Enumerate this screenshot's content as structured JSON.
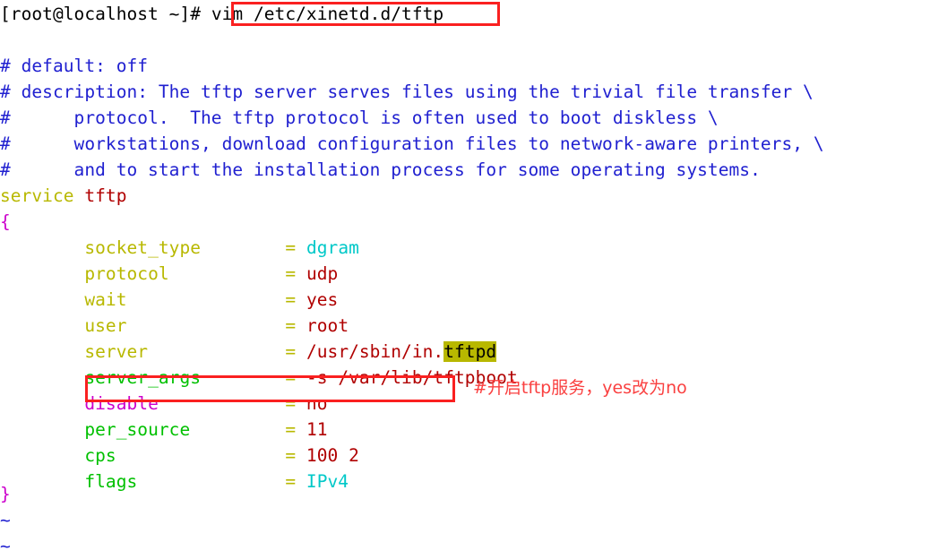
{
  "terminal": {
    "prompt": {
      "user_host": "[root@localhost ~]# ",
      "command": "vim /etc/xinetd.d/tftp"
    },
    "blank": "",
    "comments": [
      "# default: off",
      "# description: The tftp server serves files using the trivial file transfer \\",
      "#      protocol.  The tftp protocol is often used to boot diskless \\",
      "#      workstations, download configuration files to network-aware printers, \\",
      "#      and to start the installation process for some operating systems."
    ],
    "service_keyword": "service",
    "service_name": " tftp",
    "brace_open": "{",
    "brace_close": "}",
    "entries": [
      {
        "indent": "        ",
        "key": "socket_type",
        "key_color": "olive",
        "pad": "        ",
        "eq": "=",
        "value": " dgram",
        "value_color": "cyan",
        "highlight": ""
      },
      {
        "indent": "        ",
        "key": "protocol",
        "key_color": "olive",
        "pad": "           ",
        "eq": "=",
        "value": " udp",
        "value_color": "darkred",
        "highlight": ""
      },
      {
        "indent": "        ",
        "key": "wait",
        "key_color": "olive",
        "pad": "               ",
        "eq": "=",
        "value": " yes",
        "value_color": "darkred",
        "highlight": ""
      },
      {
        "indent": "        ",
        "key": "user",
        "key_color": "olive",
        "pad": "               ",
        "eq": "=",
        "value": " root",
        "value_color": "darkred",
        "highlight": ""
      },
      {
        "indent": "        ",
        "key": "server",
        "key_color": "olive",
        "pad": "             ",
        "eq": "=",
        "value": " /usr/sbin/in.",
        "value_color": "darkred",
        "highlight": "tftpd"
      },
      {
        "indent": "        ",
        "key": "server_args",
        "key_color": "green",
        "pad": "        ",
        "eq": "=",
        "value": " -s /var/lib/tftpboot",
        "value_color": "darkred",
        "highlight": ""
      },
      {
        "indent": "        ",
        "key": "disable",
        "key_color": "magenta",
        "pad": "            ",
        "eq": "=",
        "value": " no",
        "value_color": "darkred",
        "highlight": ""
      },
      {
        "indent": "        ",
        "key": "per_source",
        "key_color": "green",
        "pad": "         ",
        "eq": "=",
        "value": " 11",
        "value_color": "darkred",
        "highlight": ""
      },
      {
        "indent": "        ",
        "key": "cps",
        "key_color": "green",
        "pad": "                ",
        "eq": "=",
        "value": " 100 2",
        "value_color": "darkred",
        "highlight": ""
      },
      {
        "indent": "        ",
        "key": "flags",
        "key_color": "green",
        "pad": "              ",
        "eq": "=",
        "value": " IPv4",
        "value_color": "cyan",
        "highlight": ""
      }
    ],
    "tildes": [
      "~",
      "~"
    ]
  },
  "annotations": {
    "command_box_label": "vim /etc/xinetd.d/tftp",
    "disable_note": "#开启tftp服务，yes改为no"
  },
  "colors": {
    "background": "#ffffff",
    "comment": "#2020d0",
    "olive": "#b8b800",
    "dark_red": "#b00000",
    "magenta": "#cc00cc",
    "green": "#00c000",
    "cyan": "#00c8c8",
    "annotation_red": "#fa4040",
    "box_red": "#fa2020",
    "search_highlight_bg": "#b8b800"
  }
}
